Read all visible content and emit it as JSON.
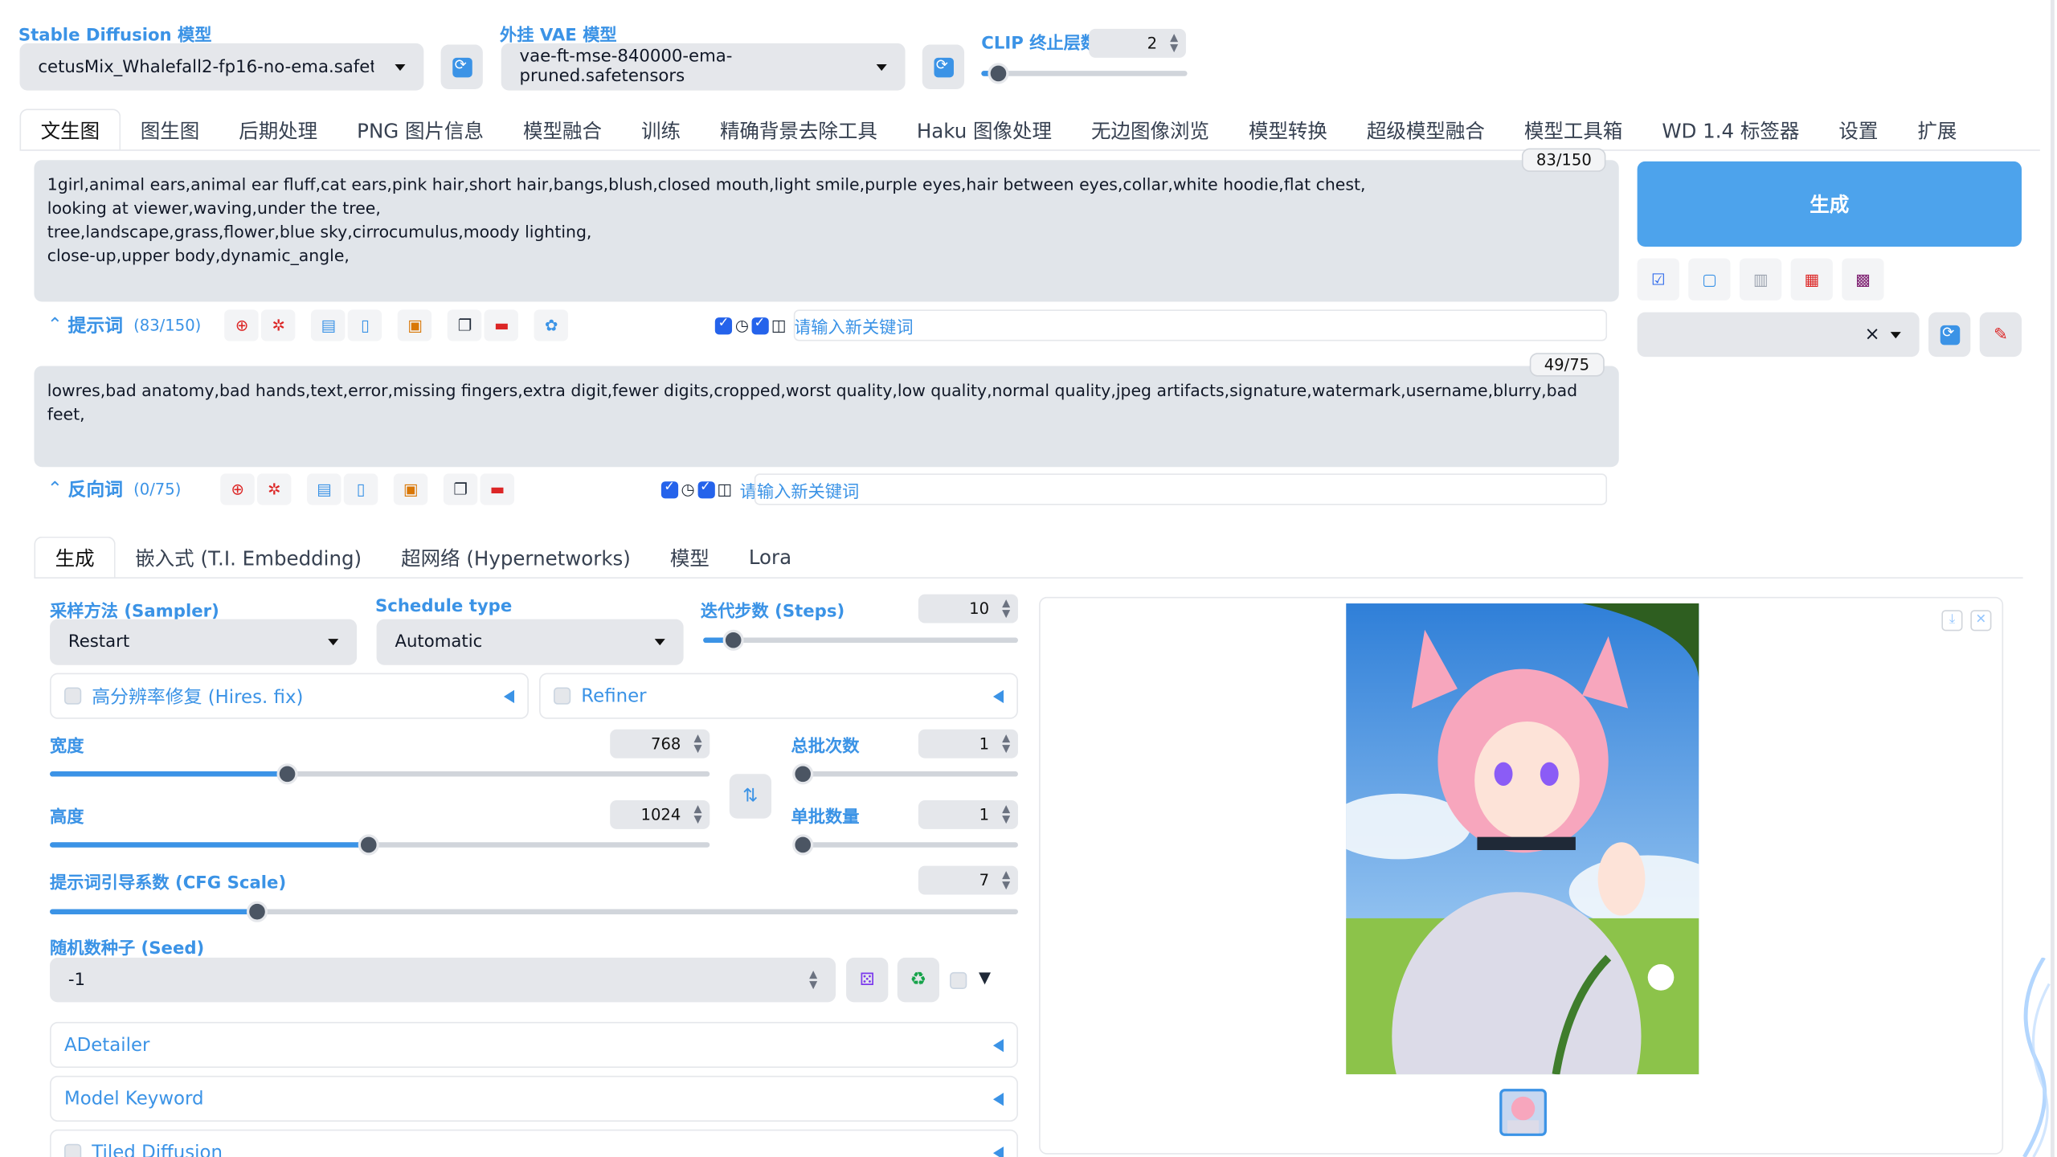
{
  "top": {
    "sd_model_label": "Stable Diffusion 模型",
    "sd_model_value": "cetusMix_Whalefall2-fp16-no-ema.safetensors",
    "vae_label": "外挂 VAE 模型",
    "vae_value": "vae-ft-mse-840000-ema-pruned.safetensors",
    "clip_label": "CLIP 终止层数",
    "clip_value": "2",
    "clip_fraction": 0.083
  },
  "main_tabs": [
    "文生图",
    "图生图",
    "后期处理",
    "PNG 图片信息",
    "模型融合",
    "训练",
    "精确背景去除工具",
    "Haku 图像处理",
    "无边图像浏览",
    "模型转换",
    "超级模型融合",
    "模型工具箱",
    "WD 1.4 标签器",
    "设置",
    "扩展"
  ],
  "prompt": {
    "text": "1girl,animal ears,animal ear fluff,cat ears,pink hair,short hair,bangs,blush,closed mouth,light smile,purple eyes,hair between eyes,collar,white hoodie,flat chest,\nlooking at viewer,waving,under the tree,\ntree,landscape,grass,flower,blue sky,cirrocumulus,moody lighting,\nclose-up,upper body,dynamic_angle,",
    "counter": "83/150",
    "title": "提示词",
    "count": "(83/150)",
    "keyword_placeholder": "请输入新关键词"
  },
  "negative": {
    "text": "lowres,bad anatomy,bad hands,text,error,missing fingers,extra digit,fewer digits,cropped,worst quality,low quality,normal quality,jpeg artifacts,signature,watermark,username,blurry,bad feet,",
    "counter": "49/75",
    "title": "反向词",
    "count": "(0/75)",
    "keyword_placeholder": "请输入新关键词"
  },
  "generate_label": "生成",
  "style_clear": "×",
  "sub_tabs": [
    "生成",
    "嵌入式 (T.I. Embedding)",
    "超网络 (Hypernetworks)",
    "模型",
    "Lora"
  ],
  "params": {
    "sampler_label": "采样方法 (Sampler)",
    "sampler_value": "Restart",
    "schedule_label": "Schedule type",
    "schedule_value": "Automatic",
    "steps_label": "迭代步数 (Steps)",
    "steps_value": "10",
    "hires_label": "高分辨率修复 (Hires. fix)",
    "refiner_label": "Refiner",
    "width_label": "宽度",
    "width_value": "768",
    "height_label": "高度",
    "height_value": "1024",
    "batch_count_label": "总批次数",
    "batch_count_value": "1",
    "batch_size_label": "单批数量",
    "batch_size_value": "1",
    "cfg_label": "提示词引导系数 (CFG Scale)",
    "cfg_value": "7",
    "seed_label": "随机数种子 (Seed)",
    "seed_value": "-1",
    "swap_icon": "⇅"
  },
  "accordions": [
    "ADetailer",
    "Model Keyword",
    "Tiled Diffusion"
  ],
  "colors": {
    "accent": "#3b93e6",
    "generate_bg": "#4da3ec"
  }
}
